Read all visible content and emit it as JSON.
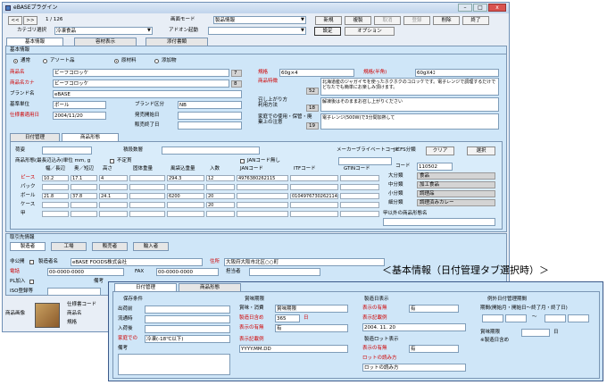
{
  "window": {
    "title": "eBASEプラグイン"
  },
  "toolbar": {
    "prev": "<<",
    "next": ">>",
    "page": "1 / 126",
    "screen_mode_label": "画面モード",
    "screen_mode_value": "製品情報",
    "btn_new": "新規",
    "btn_copy": "複製",
    "btn_cancel": "取消",
    "btn_save": "登録",
    "btn_delete": "削除",
    "btn_exit": "終了",
    "category_label": "カテゴリ選択",
    "category_value": "冷凍食品",
    "addon_label": "アドオン起動",
    "btn_settings": "設定",
    "btn_options": "オプション"
  },
  "main_tabs": [
    "基本情報",
    "容材表示",
    "添付書類"
  ],
  "basic": {
    "section": "基本情報",
    "radio_normal": "通常",
    "radio_assort": "アソート品",
    "radio_raw": "原材料",
    "radio_additive": "添加物",
    "product_name_label": "商品名",
    "product_name": "ビーフコロッケ",
    "product_name_no": "7",
    "product_kana_label": "商品名カナ",
    "product_kana": "ビーフコロッケ",
    "product_kana_no": "8",
    "brand_label": "ブランド名",
    "brand": "eBASE",
    "unit_label": "基準単位",
    "unit": "ボール",
    "brand_cat_label": "ブランド区分",
    "brand_cat": "NB",
    "spec_date_label": "仕様書適用日",
    "spec_date": "2004/11/20",
    "release_date_label": "発売開始日",
    "sale_end_label": "販売終了日",
    "standard_label": "規格",
    "standard": "60g×4",
    "standard_kana_label": "規格(半角)",
    "standard_kana": "60gX4ｺ",
    "feature_label": "商品特徴",
    "feature": "北海道産のジャガイモを使ったホクホクのコロッケです。電子レンジで調理するだけでどなたでも簡単にお楽しみ頂けます。",
    "feature_no": "52",
    "howto_label1": "召し上がり方",
    "howto_label2": "利用方法",
    "howto": "解凍後はそのままお召し上がりください",
    "howto_no": "18",
    "caution_label1": "家庭での使用・保管・廃",
    "caution_label2": "棄上の注意",
    "caution": "電子レンジ(500W)で3分間加熱して",
    "caution_no": "19"
  },
  "sub_tabs": [
    "日付管理",
    "商品形態"
  ],
  "form": {
    "shape_label": "荷姿",
    "pack_label": "積段数層",
    "maker_code_label": "メーカーブライベートコード",
    "jicfs_label": "JICFS分類",
    "btn_clear": "クリア",
    "btn_select": "選択",
    "unit_label": "商品形態(最長辺込み)単位 mm, g",
    "irregular_label": "不定貫",
    "jan_none_label": "JANコード無し",
    "code_label": "コード",
    "code_value": "110502",
    "cat_large_label": "大分類",
    "cat_large": "食品",
    "cat_mid_label": "中分類",
    "cat_mid": "加工食品",
    "cat_small_label": "小分類",
    "cat_small": "調理品",
    "cat_detail_label": "細分類",
    "cat_detail": "調理済みカレー",
    "other_cat_label": "甲以外の商品形態名",
    "headers": [
      "幅／長辺",
      "奥／短辺",
      "高さ",
      "固体重量",
      "風袋込重量",
      "入数",
      "JANコード",
      "ITFコード",
      "GTINコード"
    ],
    "rows": [
      {
        "label": "ピース",
        "cells": [
          "10.2",
          "17.1",
          "4",
          "",
          "294.3",
          "12",
          "4976380262115",
          "",
          ""
        ]
      },
      {
        "label": "パック",
        "cells": [
          "",
          "",
          "",
          "",
          "",
          "",
          "",
          "",
          ""
        ]
      },
      {
        "label": "ボール",
        "cells": [
          "21.8",
          "37.8",
          "24.1",
          "",
          "6200",
          "20",
          "",
          "0104976730262114",
          ""
        ]
      },
      {
        "label": "ケース",
        "cells": [
          "",
          "",
          "",
          "",
          "",
          "20",
          "",
          "",
          ""
        ]
      },
      {
        "label": "甲",
        "cells": [
          "",
          "",
          "",
          "",
          "",
          "",
          "",
          "",
          ""
        ]
      }
    ]
  },
  "supplier": {
    "section": "取引先情報",
    "tabs": [
      "製造者",
      "工場",
      "販売者",
      "輸入者"
    ],
    "public_label": "非公開",
    "maker_code_label": "製造者名",
    "maker": "eBASE FOODS株式会社",
    "address_label": "住所",
    "address": "大阪府大阪市北区○○町",
    "tel_label": "電話",
    "tel": "00-0000-0000",
    "fax_label": "FAX",
    "fax": "00-0000-0000",
    "person_label": "担当者",
    "pl_label": "PL加入",
    "remarks_label": "備考",
    "iso_label": "ISO登録等"
  },
  "bottom": {
    "image_label": "商品画像",
    "spec_code_label": "仕様書コード",
    "product_name_label": "商品名",
    "standard_label": "規格"
  },
  "caption": "＜基本情報（日付管理タブ選択時）＞",
  "zoom": {
    "tabs": [
      "日付管理",
      "商品形態"
    ],
    "storage_title": "保存条件",
    "shipping_label": "出荷前",
    "distribution_label": "流通時",
    "arrival_label": "入荷後",
    "home_label": "家庭での",
    "home_value": "冷凍(-18℃以下)",
    "remarks_label": "備考",
    "expiry_title": "賞味期限",
    "expiry_type_label": "賞味・消費",
    "expiry_type": "賞味期限",
    "days_label": "製造日含め",
    "days_value": "365",
    "days_unit": "日",
    "display_label": "表示の有無",
    "display_value": "有",
    "format_label": "表示記載例",
    "format_value": "YYYY.MM.DD",
    "mfg_title": "製造日表示",
    "mfg_display_label": "表示の有無",
    "mfg_display": "有",
    "mfg_format_label": "表示記載例",
    "mfg_format": "2004. 11. 20",
    "lot_title": "製造ロット表示",
    "lot_display_label": "表示の有無",
    "lot_display": "有",
    "lot_read_label": "ロットの読み方",
    "lot_read": "ロットの読み方",
    "exception_title": "例外日付管理期間",
    "period_label": "期間(開始月・開始日～終了月・終了日)",
    "tilde": "～",
    "exp_period_label": "賞味期限",
    "exp_period_unit": "日",
    "exp_note": "※製造日含め"
  }
}
